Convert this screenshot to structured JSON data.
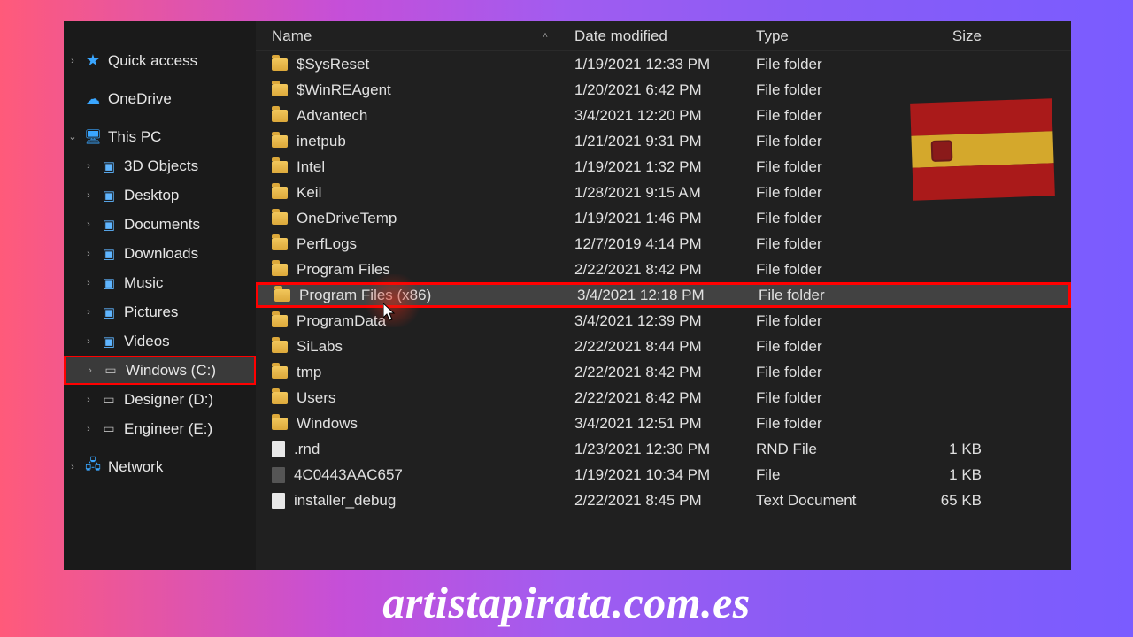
{
  "sidebar": {
    "quick_access": "Quick access",
    "onedrive": "OneDrive",
    "this_pc": "This PC",
    "items": [
      {
        "label": "3D Objects"
      },
      {
        "label": "Desktop"
      },
      {
        "label": "Documents"
      },
      {
        "label": "Downloads"
      },
      {
        "label": "Music"
      },
      {
        "label": "Pictures"
      },
      {
        "label": "Videos"
      }
    ],
    "drives": [
      {
        "label": "Windows (C:)",
        "selected": true
      },
      {
        "label": "Designer (D:)"
      },
      {
        "label": "Engineer (E:)"
      }
    ],
    "network": "Network"
  },
  "columns": {
    "name": "Name",
    "date": "Date modified",
    "type": "Type",
    "size": "Size"
  },
  "rows": [
    {
      "name": "$SysReset",
      "date": "1/19/2021 12:33 PM",
      "type": "File folder",
      "size": "",
      "kind": "folder"
    },
    {
      "name": "$WinREAgent",
      "date": "1/20/2021 6:42 PM",
      "type": "File folder",
      "size": "",
      "kind": "folder"
    },
    {
      "name": "Advantech",
      "date": "3/4/2021 12:20 PM",
      "type": "File folder",
      "size": "",
      "kind": "folder"
    },
    {
      "name": "inetpub",
      "date": "1/21/2021 9:31 PM",
      "type": "File folder",
      "size": "",
      "kind": "folder"
    },
    {
      "name": "Intel",
      "date": "1/19/2021 1:32 PM",
      "type": "File folder",
      "size": "",
      "kind": "folder"
    },
    {
      "name": "Keil",
      "date": "1/28/2021 9:15 AM",
      "type": "File folder",
      "size": "",
      "kind": "folder"
    },
    {
      "name": "OneDriveTemp",
      "date": "1/19/2021 1:46 PM",
      "type": "File folder",
      "size": "",
      "kind": "folder"
    },
    {
      "name": "PerfLogs",
      "date": "12/7/2019 4:14 PM",
      "type": "File folder",
      "size": "",
      "kind": "folder"
    },
    {
      "name": "Program Files",
      "date": "2/22/2021 8:42 PM",
      "type": "File folder",
      "size": "",
      "kind": "folder"
    },
    {
      "name": "Program Files (x86)",
      "date": "3/4/2021 12:18 PM",
      "type": "File folder",
      "size": "",
      "kind": "folder",
      "selected": true
    },
    {
      "name": "ProgramData",
      "date": "3/4/2021 12:39 PM",
      "type": "File folder",
      "size": "",
      "kind": "folder"
    },
    {
      "name": "SiLabs",
      "date": "2/22/2021 8:44 PM",
      "type": "File folder",
      "size": "",
      "kind": "folder"
    },
    {
      "name": "tmp",
      "date": "2/22/2021 8:42 PM",
      "type": "File folder",
      "size": "",
      "kind": "folder"
    },
    {
      "name": "Users",
      "date": "2/22/2021 8:42 PM",
      "type": "File folder",
      "size": "",
      "kind": "folder"
    },
    {
      "name": "Windows",
      "date": "3/4/2021 12:51 PM",
      "type": "File folder",
      "size": "",
      "kind": "folder"
    },
    {
      "name": ".rnd",
      "date": "1/23/2021 12:30 PM",
      "type": "RND File",
      "size": "1 KB",
      "kind": "file"
    },
    {
      "name": "4C0443AAC657",
      "date": "1/19/2021 10:34 PM",
      "type": "File",
      "size": "1 KB",
      "kind": "file-dark"
    },
    {
      "name": "installer_debug",
      "date": "2/22/2021 8:45 PM",
      "type": "Text Document",
      "size": "65 KB",
      "kind": "file"
    }
  ],
  "caption": "artistapirata.com.es"
}
